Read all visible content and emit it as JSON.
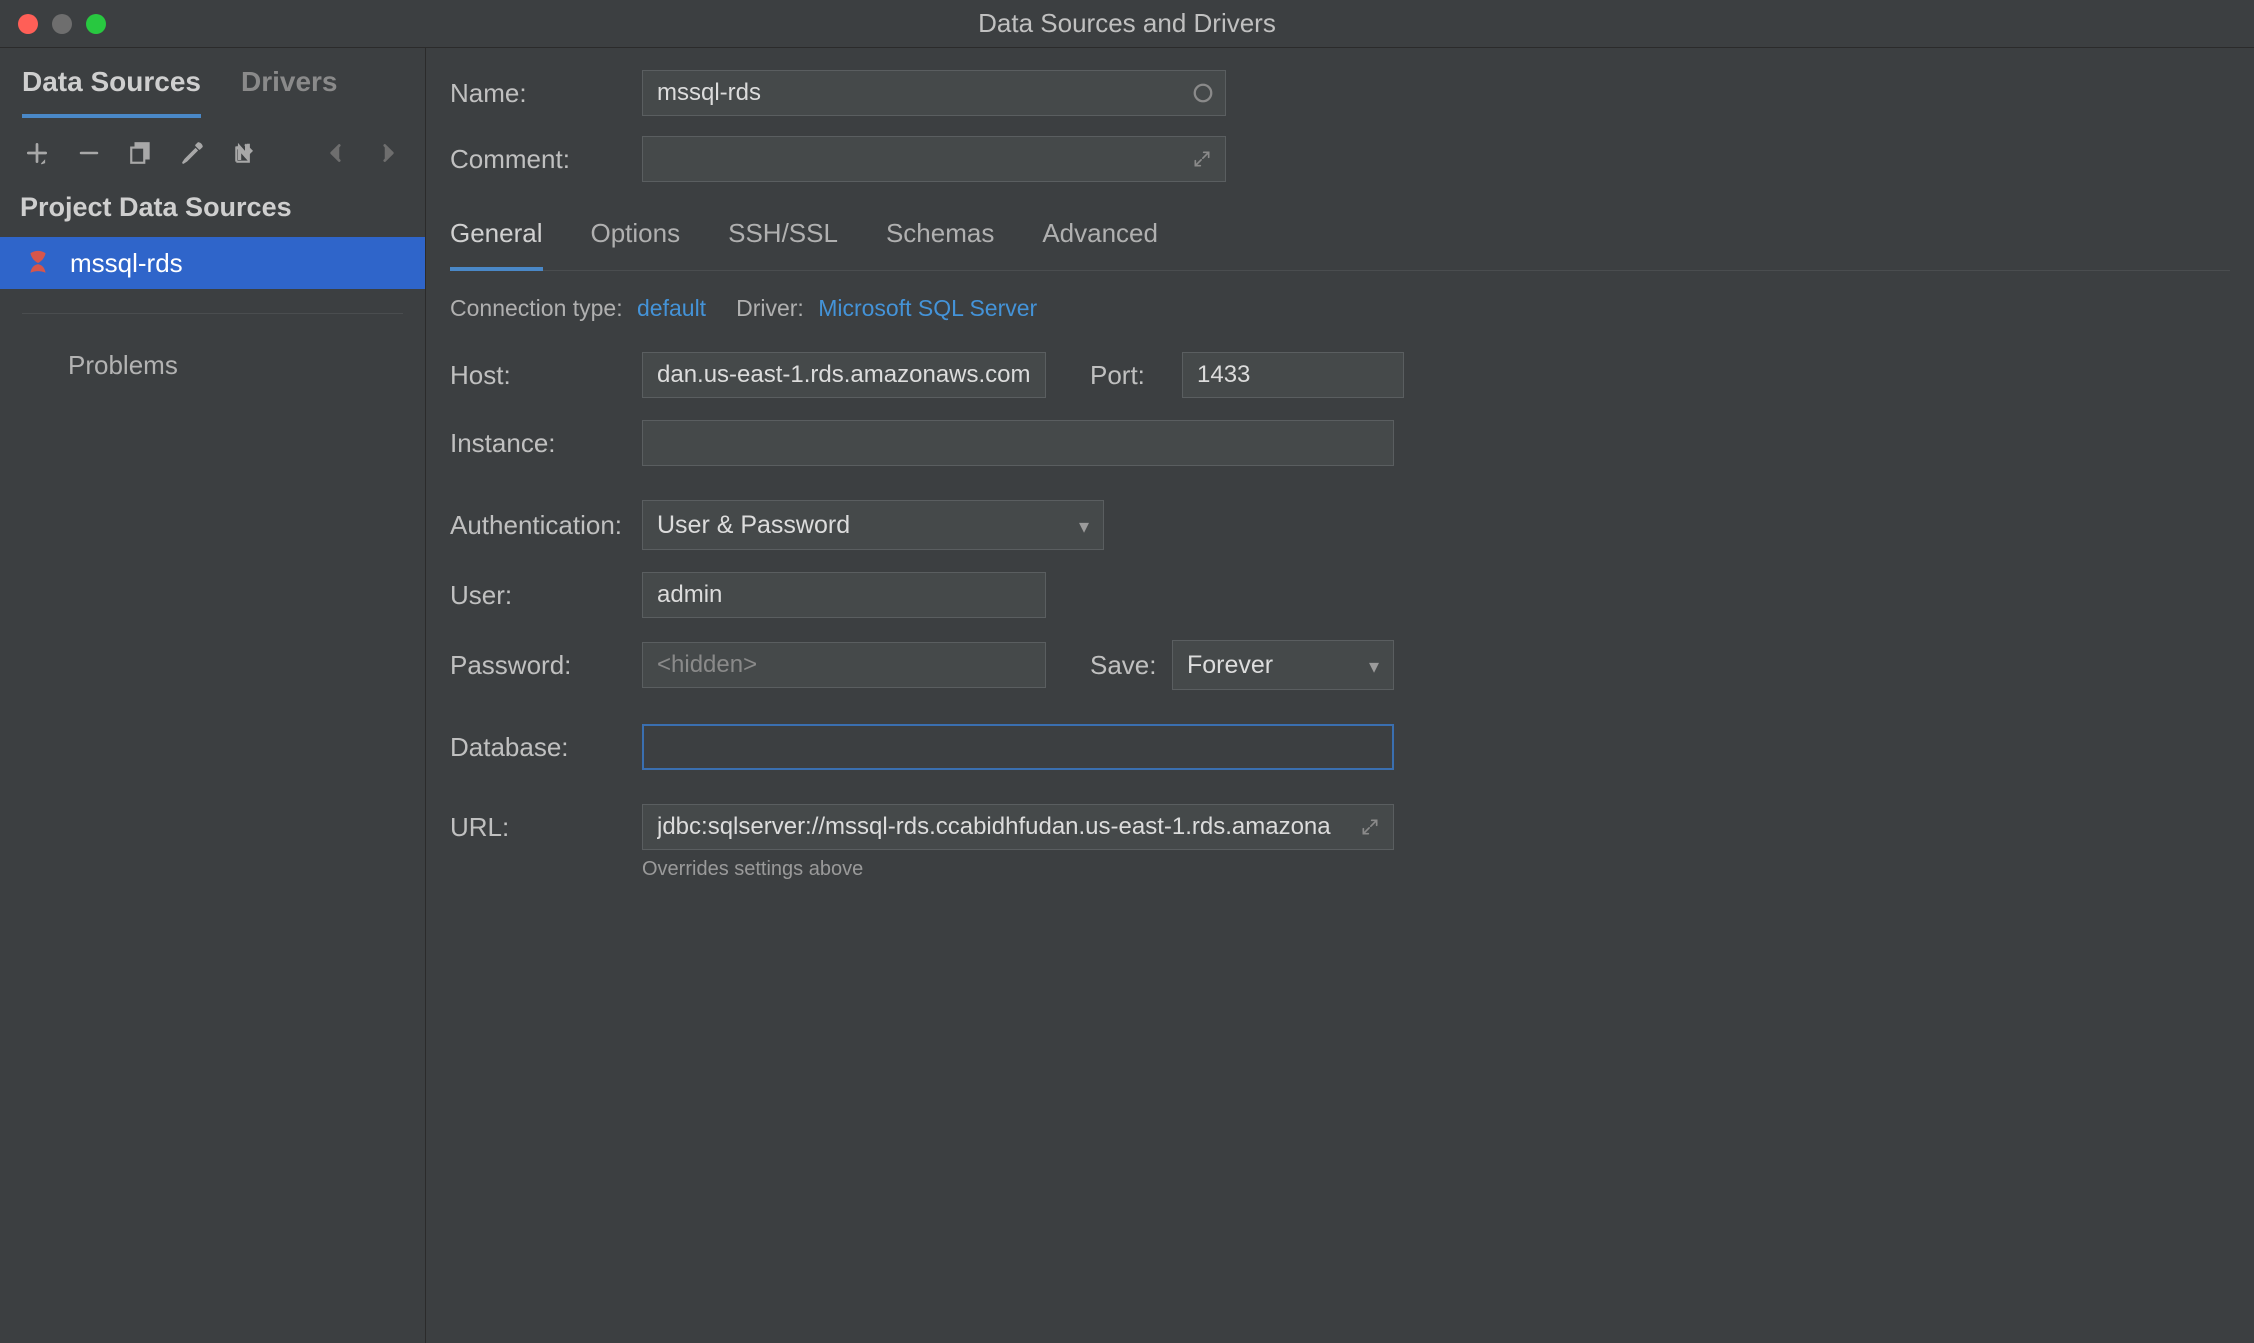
{
  "window": {
    "title": "Data Sources and Drivers"
  },
  "sidebar": {
    "tabs": [
      {
        "label": "Data Sources",
        "active": true
      },
      {
        "label": "Drivers",
        "active": false
      }
    ],
    "section_header": "Project Data Sources",
    "items": [
      {
        "label": "mssql-rds",
        "selected": true
      }
    ],
    "problems_label": "Problems"
  },
  "form": {
    "name_label": "Name:",
    "name_value": "mssql-rds",
    "comment_label": "Comment:",
    "comment_value": ""
  },
  "config_tabs": [
    {
      "label": "General",
      "active": true
    },
    {
      "label": "Options"
    },
    {
      "label": "SSH/SSL"
    },
    {
      "label": "Schemas"
    },
    {
      "label": "Advanced"
    }
  ],
  "meta": {
    "connection_type_label": "Connection type:",
    "connection_type_value": "default",
    "driver_label": "Driver:",
    "driver_value": "Microsoft SQL Server"
  },
  "conn": {
    "host_label": "Host:",
    "host_value": "dan.us-east-1.rds.amazonaws.com",
    "port_label": "Port:",
    "port_value": "1433",
    "instance_label": "Instance:",
    "instance_value": "",
    "auth_label": "Authentication:",
    "auth_value": "User & Password",
    "user_label": "User:",
    "user_value": "admin",
    "password_label": "Password:",
    "password_placeholder": "<hidden>",
    "save_label": "Save:",
    "save_value": "Forever",
    "database_label": "Database:",
    "database_value": "",
    "url_label": "URL:",
    "url_value": "jdbc:sqlserver://mssql-rds.ccabidhfudan.us-east-1.rds.amazona",
    "url_hint": "Overrides settings above"
  }
}
